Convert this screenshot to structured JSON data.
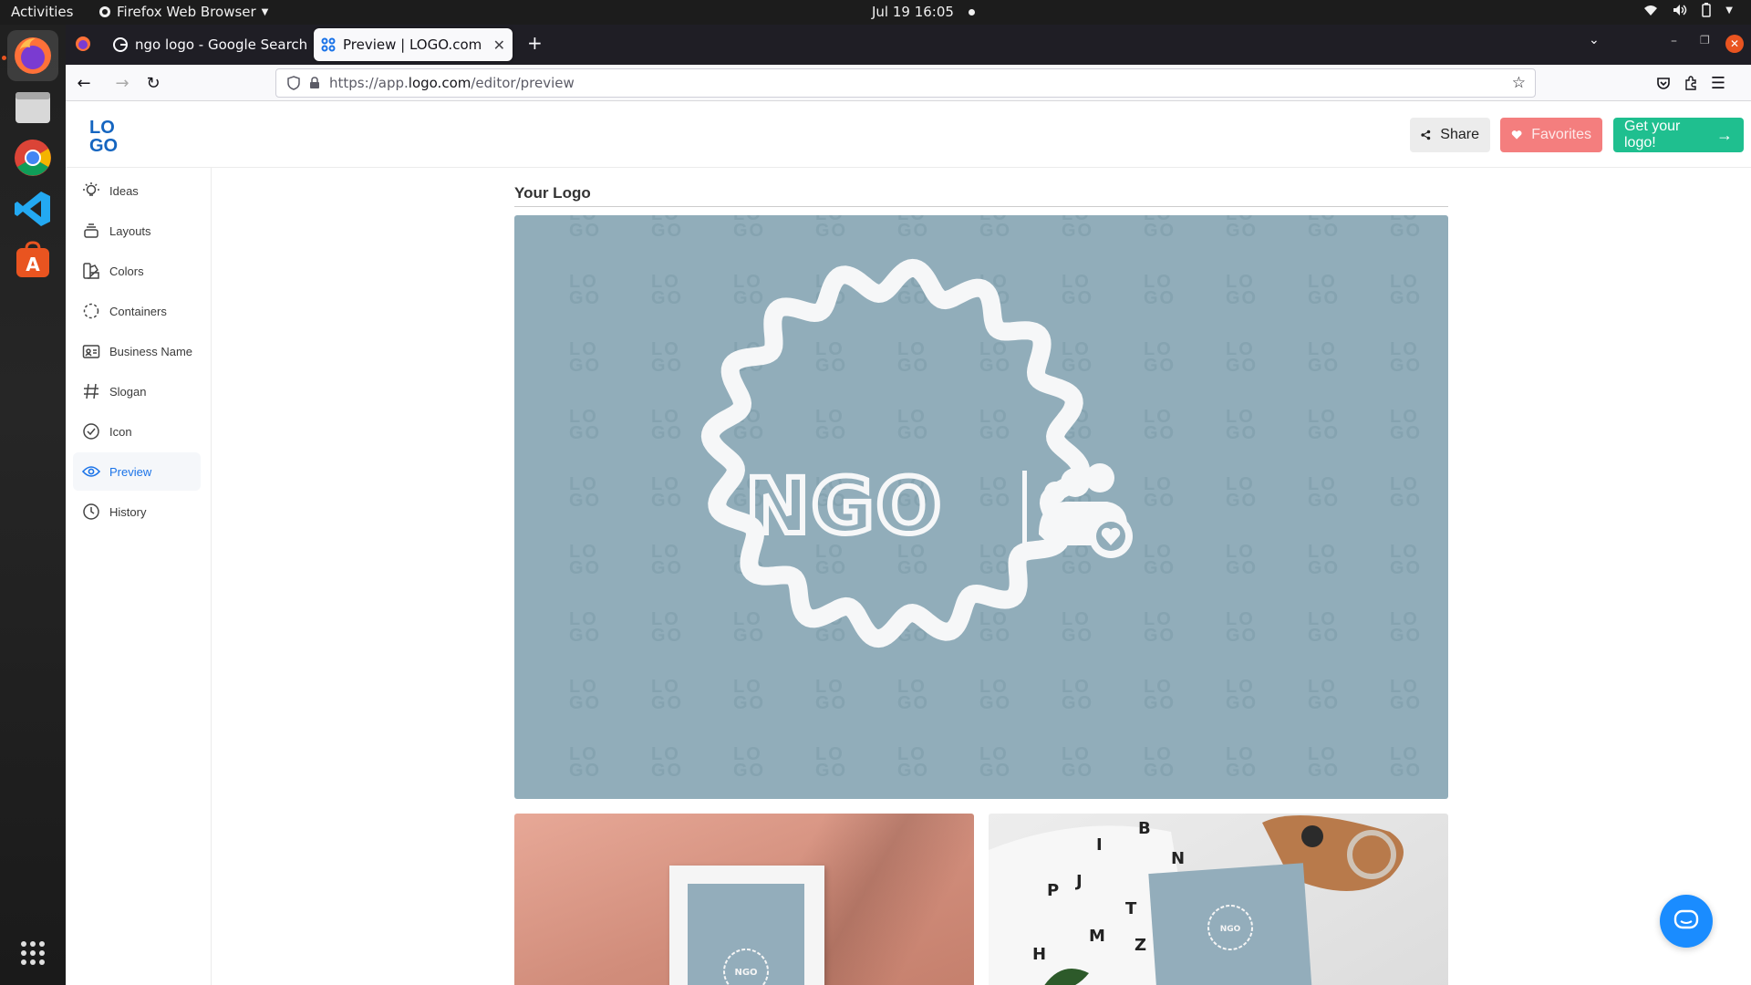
{
  "system": {
    "activities": "Activities",
    "app_name": "Firefox Web Browser",
    "clock": "Jul 19  16:05"
  },
  "browser": {
    "tabs": [
      {
        "title": "ngo logo - Google Search",
        "icon": "google-icon"
      },
      {
        "title": "Preview | LOGO.com",
        "icon": "logo-com-icon",
        "active": true
      }
    ],
    "url_prefix": "https://app.",
    "url_host": "logo.com",
    "url_path": "/editor/preview"
  },
  "header": {
    "logo_text": "LOGO",
    "share_label": "Share",
    "favorites_label": "Favorites",
    "get_logo_label": "Get your logo!"
  },
  "sidebar": {
    "items": [
      {
        "label": "Ideas",
        "icon": "lightbulb-icon"
      },
      {
        "label": "Layouts",
        "icon": "layers-icon"
      },
      {
        "label": "Colors",
        "icon": "palette-icon"
      },
      {
        "label": "Containers",
        "icon": "container-icon"
      },
      {
        "label": "Business Name",
        "icon": "id-card-icon"
      },
      {
        "label": "Slogan",
        "icon": "hashtag-icon"
      },
      {
        "label": "Icon",
        "icon": "check-circle-icon"
      },
      {
        "label": "Preview",
        "icon": "eye-icon",
        "active": true
      },
      {
        "label": "History",
        "icon": "clock-icon"
      }
    ]
  },
  "main": {
    "section_title": "Your Logo",
    "logo_name": "NGO",
    "watermark": "LOGO",
    "mini_logo_text": "NGO"
  },
  "colors": {
    "preview_bg": "#91adba",
    "accent": "#1a73e8",
    "favorites": "#f47e7e",
    "cta": "#1fbf8f"
  }
}
